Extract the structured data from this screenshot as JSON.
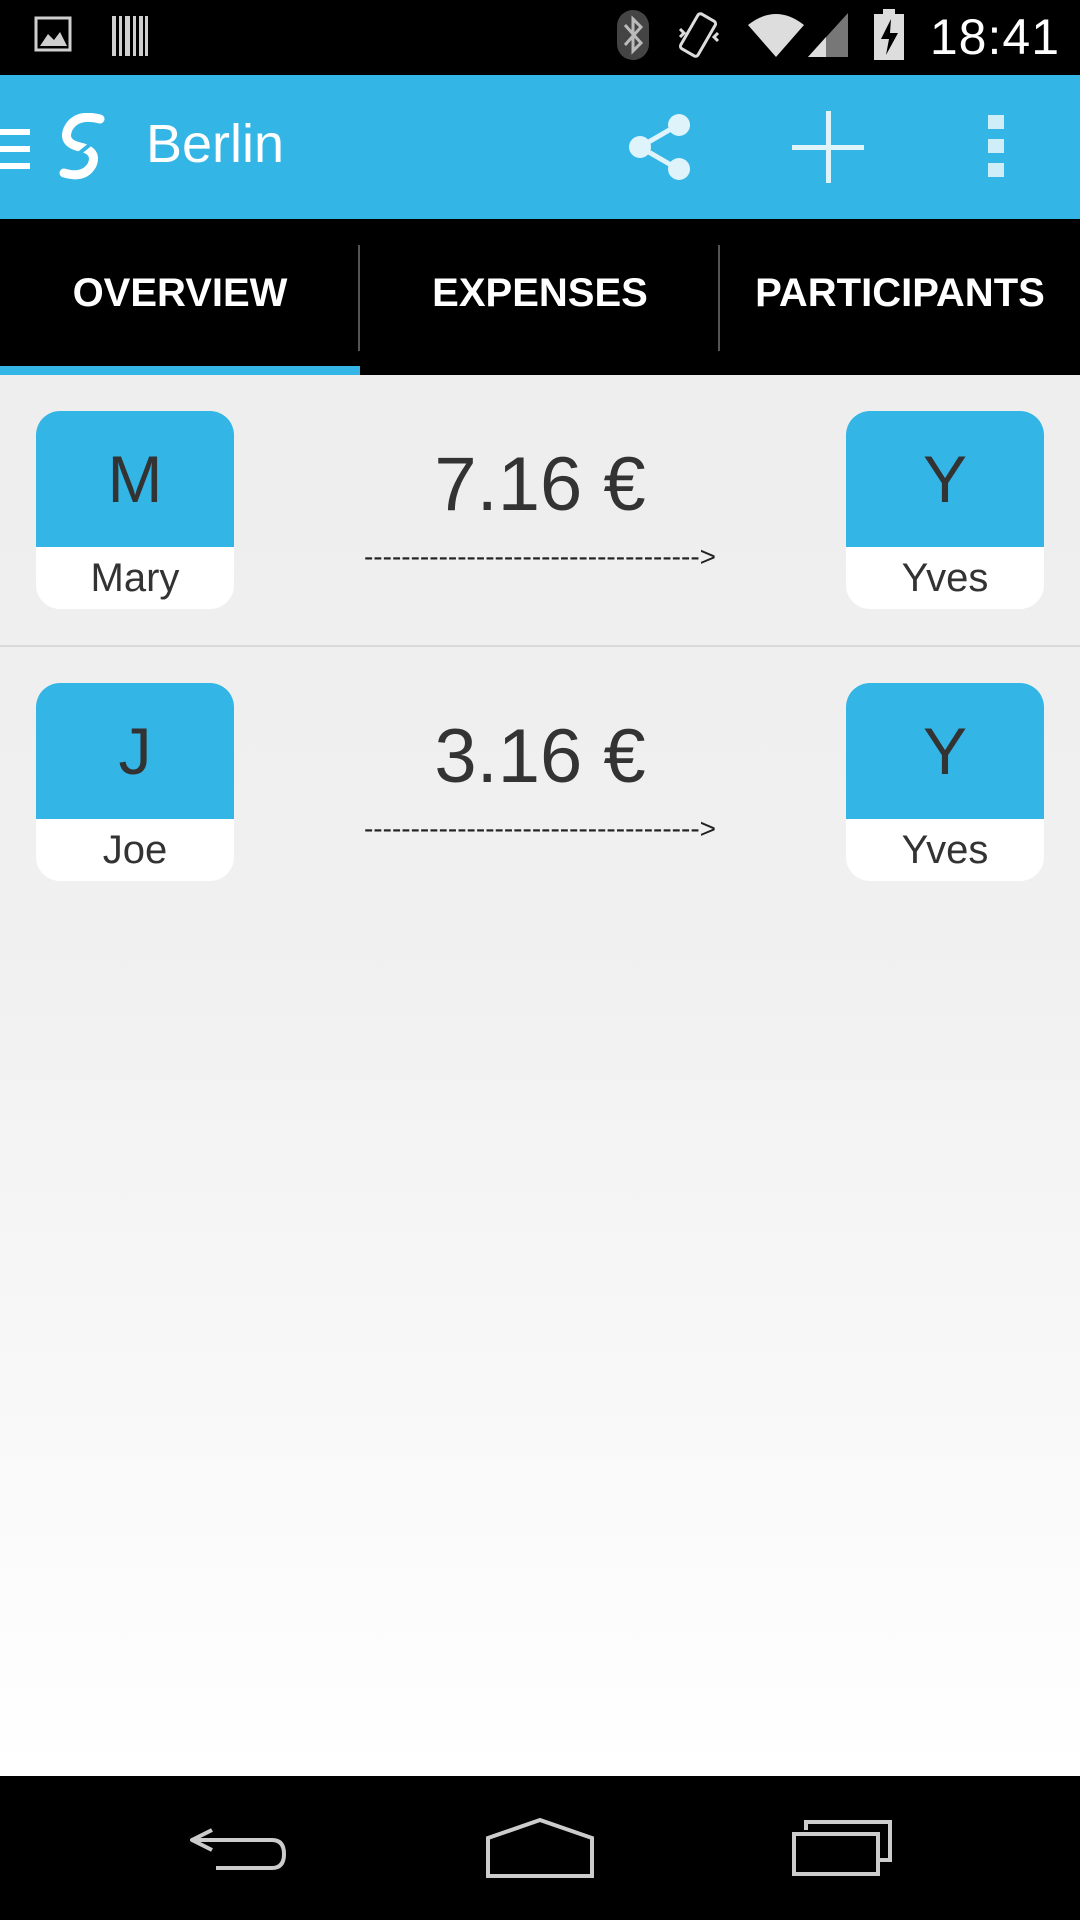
{
  "status_bar": {
    "time": "18:41",
    "icons": [
      "gallery-notification-icon",
      "barcode-notification-icon",
      "bluetooth-icon",
      "vibrate-icon",
      "wifi-icon",
      "signal-icon",
      "battery-charging-icon"
    ]
  },
  "action_bar": {
    "title": "Berlin",
    "icons": [
      "drawer-icon",
      "app-logo-icon",
      "share-icon",
      "add-icon",
      "overflow-menu-icon"
    ],
    "accent_color": "#33b5e5"
  },
  "tabs": [
    {
      "label": "OVERVIEW",
      "selected": true
    },
    {
      "label": "EXPENSES",
      "selected": false
    },
    {
      "label": "PARTICIPANTS",
      "selected": false
    }
  ],
  "transfers": [
    {
      "from": {
        "initial": "M",
        "name": "Mary"
      },
      "amount": "7.16 €",
      "arrow": "------------------------------------>",
      "to": {
        "initial": "Y",
        "name": "Yves"
      }
    },
    {
      "from": {
        "initial": "J",
        "name": "Joe"
      },
      "amount": "3.16 €",
      "arrow": "------------------------------------>",
      "to": {
        "initial": "Y",
        "name": "Yves"
      }
    }
  ],
  "nav_bar": {
    "icons": [
      "back-icon",
      "home-icon",
      "recent-apps-icon"
    ]
  }
}
